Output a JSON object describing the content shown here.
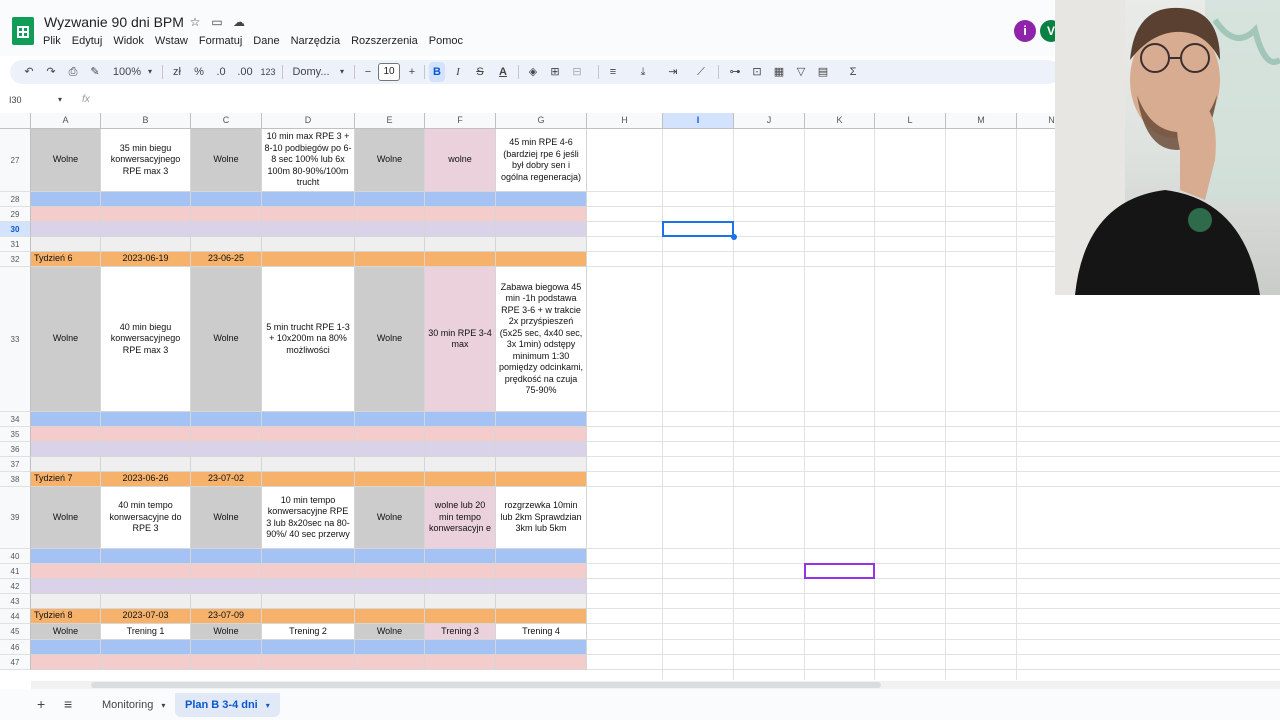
{
  "app": {
    "doc_title": "Wyzwanie 90 dni BPM",
    "menu": [
      "Plik",
      "Edytuj",
      "Widok",
      "Wstaw",
      "Formatuj",
      "Dane",
      "Narzędzia",
      "Rozszerzenia",
      "Pomoc"
    ]
  },
  "toolbar": {
    "zoom": "100%",
    "currency": "zł",
    "percent": "%",
    "dec_decrease": ".0",
    "dec_increase": ".00",
    "number_format": "123",
    "font": "Domy...",
    "font_size": "10",
    "bold": "B",
    "italic": "I",
    "strike": "S",
    "text_color": "A",
    "sum": "Σ"
  },
  "formula_bar": {
    "name_box": "I30",
    "fx": "fx"
  },
  "columns": [
    "A",
    "B",
    "C",
    "D",
    "E",
    "F",
    "G",
    "H",
    "I",
    "J",
    "K",
    "L",
    "M",
    "N"
  ],
  "selected_column": "I",
  "rows": [
    {
      "num": "27",
      "cells": [
        "Wolne",
        "35 min biegu konwersacyjnego RPE max 3",
        "Wolne",
        "10 min max RPE 3 + 8-10 podbiegów po 6-8 sec 100% lub 6x 100m 80-90%/100m trucht",
        "Wolne",
        "wolne",
        "45 min RPE 4-6 (bardziej rpe 6 jeśli był dobry sen i ogólna regeneracja)"
      ]
    },
    {
      "num": "28",
      "cells": [
        "",
        "",
        "",
        "",
        "",
        "",
        ""
      ]
    },
    {
      "num": "29",
      "cells": [
        "",
        "",
        "",
        "",
        "",
        "",
        ""
      ]
    },
    {
      "num": "30",
      "cells": [
        "",
        "",
        "",
        "",
        "",
        "",
        ""
      ]
    },
    {
      "num": "31",
      "cells": [
        "",
        "",
        "",
        "",
        "",
        "",
        ""
      ]
    },
    {
      "num": "32",
      "cells": [
        "Tydzień 6",
        "2023-06-19",
        "23-06-25",
        "",
        "",
        "",
        ""
      ]
    },
    {
      "num": "33",
      "cells": [
        "Wolne",
        "40 min biegu konwersacyjnego RPE max 3",
        "Wolne",
        "5 min trucht RPE 1-3 + 10x200m na 80% możliwości",
        "Wolne",
        "30 min RPE 3-4 max",
        "Zabawa biegowa 45 min -1h podstawa RPE 3-6 + w trakcie 2x przyśpieszeń (5x25 sec, 4x40 sec, 3x 1min) odstępy minimum 1:30 pomiędzy odcinkami, prędkość na czuja 75-90%"
      ]
    },
    {
      "num": "34",
      "cells": [
        "",
        "",
        "",
        "",
        "",
        "",
        ""
      ]
    },
    {
      "num": "35",
      "cells": [
        "",
        "",
        "",
        "",
        "",
        "",
        ""
      ]
    },
    {
      "num": "36",
      "cells": [
        "",
        "",
        "",
        "",
        "",
        "",
        ""
      ]
    },
    {
      "num": "37",
      "cells": [
        "",
        "",
        "",
        "",
        "",
        "",
        ""
      ]
    },
    {
      "num": "38",
      "cells": [
        "Tydzień 7",
        "2023-06-26",
        "23-07-02",
        "",
        "",
        "",
        ""
      ]
    },
    {
      "num": "39",
      "cells": [
        "Wolne",
        "40 min tempo konwersacyjne do RPE 3",
        "Wolne",
        "10 min tempo konwersacyjne RPE 3 lub 8x20sec na 80-90%/ 40 sec przerwy",
        "Wolne",
        "wolne lub 20 min tempo konwersacyjn e",
        "rozgrzewka 10min lub 2km Sprawdzian 3km lub 5km"
      ]
    },
    {
      "num": "40",
      "cells": [
        "",
        "",
        "",
        "",
        "",
        "",
        ""
      ]
    },
    {
      "num": "41",
      "cells": [
        "",
        "",
        "",
        "",
        "",
        "",
        ""
      ]
    },
    {
      "num": "42",
      "cells": [
        "",
        "",
        "",
        "",
        "",
        "",
        ""
      ]
    },
    {
      "num": "43",
      "cells": [
        "",
        "",
        "",
        "",
        "",
        "",
        ""
      ]
    },
    {
      "num": "44",
      "cells": [
        "Tydzień 8",
        "2023-07-03",
        "23-07-09",
        "",
        "",
        "",
        ""
      ]
    },
    {
      "num": "45",
      "cells": [
        "Wolne",
        "Trening 1",
        "Wolne",
        "Trening 2",
        "Wolne",
        "Trening 3",
        "Trening 4"
      ]
    },
    {
      "num": "46",
      "cells": [
        "",
        "",
        "",
        "",
        "",
        "",
        ""
      ]
    },
    {
      "num": "47",
      "cells": [
        "",
        "",
        "",
        "",
        "",
        "",
        ""
      ]
    }
  ],
  "colors": {
    "gray": "#cccccc",
    "pink_col": "#ead1dc",
    "blue_row": "#a4c2f4",
    "red_row": "#f4cccc",
    "purple_row": "#d9d2e9",
    "light_row": "#efefef",
    "orange_row": "#f6b26b",
    "accent": "#1a73e8"
  },
  "sheet_tabs": [
    "Monitoring",
    "Plan B 3-4 dni"
  ],
  "active_tab": "Plan B 3-4 dni"
}
